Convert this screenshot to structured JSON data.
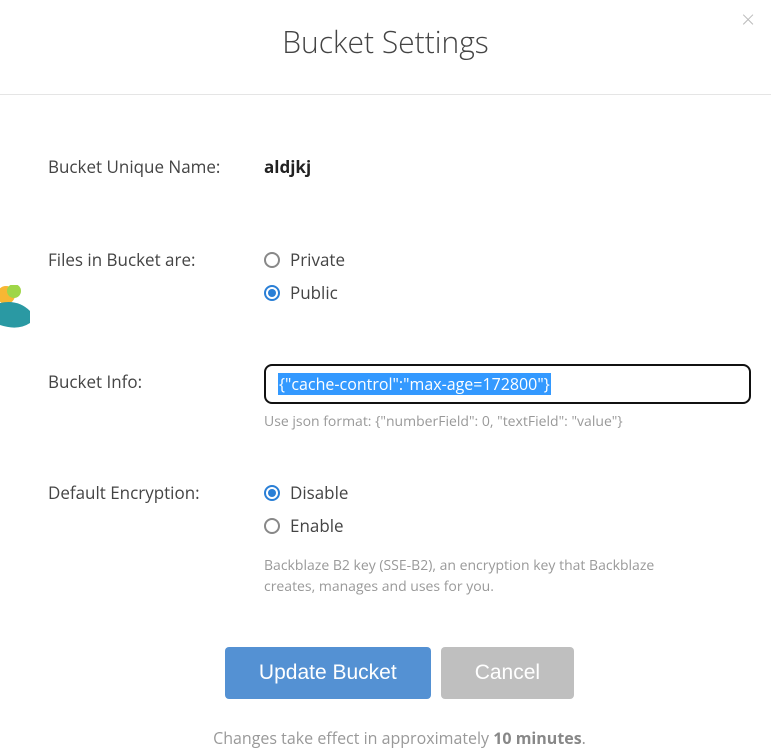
{
  "modal": {
    "title": "Bucket Settings"
  },
  "fields": {
    "name_label": "Bucket Unique Name:",
    "name_value": "aldjkj",
    "privacy_label": "Files in Bucket are:",
    "privacy_options": {
      "private": "Private",
      "public": "Public"
    },
    "privacy_selected": "public",
    "info_label": "Bucket Info:",
    "info_value": "{\"cache-control\":\"max-age=172800\"}",
    "info_helper": "Use json format: {\"numberField\": 0, \"textField\": \"value\"}",
    "encryption_label": "Default Encryption:",
    "encryption_options": {
      "disable": "Disable",
      "enable": "Enable"
    },
    "encryption_selected": "disable",
    "encryption_helper": "Backblaze B2 key (SSE-B2), an encryption key that Backblaze creates, manages and uses for you."
  },
  "actions": {
    "update": "Update Bucket",
    "cancel": "Cancel"
  },
  "footer": {
    "pre": "Changes take effect in approximately ",
    "strong": "10 minutes",
    "post": "."
  }
}
